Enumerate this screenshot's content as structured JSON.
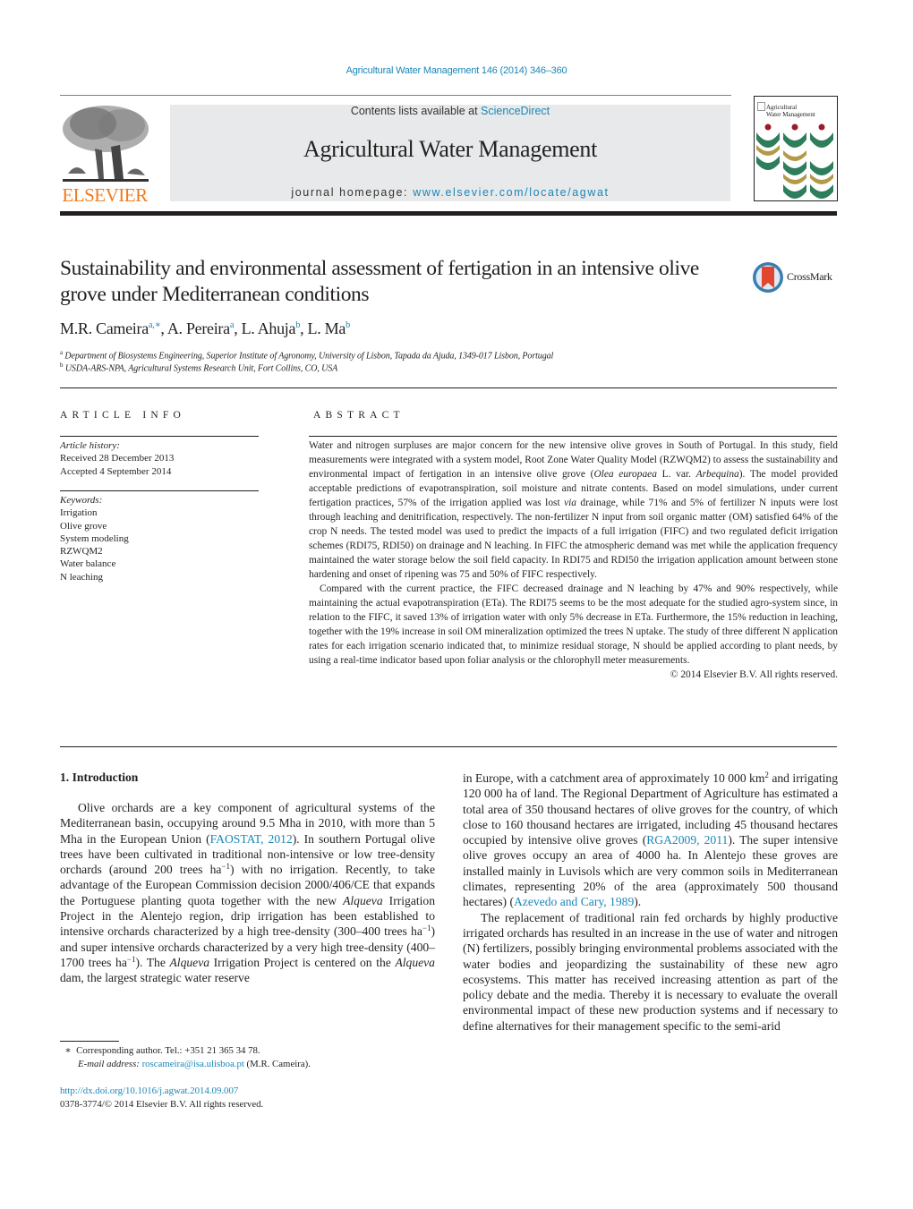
{
  "citation": "Agricultural Water Management 146 (2014) 346–360",
  "header": {
    "publisher_logo_text": "ELSEVIER",
    "contents_prefix": "Contents lists available at ",
    "contents_link": "ScienceDirect",
    "journal_title": "Agricultural Water Management",
    "homepage_prefix": "journal homepage: ",
    "homepage_link": "www.elsevier.com/locate/agwat",
    "cover_title_line1": "Agricultural",
    "cover_title_line2": "Water Management"
  },
  "article": {
    "title": "Sustainability and environmental assessment of fertigation in an intensive olive grove under Mediterranean conditions",
    "crossmark_label": "CrossMark",
    "authors": [
      {
        "name": "M.R. Cameira",
        "sup": "a,∗"
      },
      {
        "name": "A. Pereira",
        "sup": "a"
      },
      {
        "name": "L. Ahuja",
        "sup": "b"
      },
      {
        "name": "L. Ma",
        "sup": "b"
      }
    ],
    "affiliations": [
      {
        "mark": "a",
        "text": "Department of Biosystems Engineering, Superior Institute of Agronomy, University of Lisbon, Tapada da Ajuda, 1349-017 Lisbon, Portugal"
      },
      {
        "mark": "b",
        "text": "USDA-ARS-NPA, Agricultural Systems Research Unit, Fort Collins, CO, USA"
      }
    ]
  },
  "article_info": {
    "heading": "ARTICLE INFO",
    "history_label": "Article history:",
    "received": "Received 28 December 2013",
    "accepted": "Accepted 4 September 2014",
    "keywords_label": "Keywords:",
    "keywords": [
      "Irrigation",
      "Olive grove",
      "System modeling",
      "RZWQM2",
      "Water balance",
      "N leaching"
    ]
  },
  "abstract": {
    "heading": "ABSTRACT",
    "p1_a": "Water and nitrogen surpluses are major concern for the new intensive olive groves in South of Portugal. In this study, field measurements were integrated with a system model, Root Zone Water Quality Model (RZWQM2) to assess the sustainability and environmental impact of fertigation in an intensive olive grove (",
    "p1_species": "Olea europaea",
    "p1_b": " L. var. ",
    "p1_variety": "Arbequina",
    "p1_c": "). The model provided acceptable predictions of evapotranspiration, soil moisture and nitrate contents. Based on model simulations, under current fertigation practices, 57% of the irrigation applied was lost ",
    "p1_via": "via",
    "p1_d": " drainage, while 71% and 5% of fertilizer N inputs were lost through leaching and denitrification, respectively. The non-fertilizer N input from soil organic matter (OM) satisfied 64% of the crop N needs. The tested model was used to predict the impacts of a full irrigation (FIFC) and two regulated deficit irrigation schemes (RDI75, RDI50) on drainage and N leaching. In FIFC the atmospheric demand was met while the application frequency maintained the water storage below the soil field capacity. In RDI75 and RDI50 the irrigation application amount between stone hardening and onset of ripening was 75 and 50% of FIFC respectively.",
    "p2": "Compared with the current practice, the FIFC decreased drainage and N leaching by 47% and 90% respectively, while maintaining the actual evapotranspiration (ETa). The RDI75 seems to be the most adequate for the studied agro-system since, in relation to the FIFC, it saved 13% of irrigation water with only 5% decrease in ETa. Furthermore, the 15% reduction in leaching, together with the 19% increase in soil OM mineralization optimized the trees N uptake. The study of three different N application rates for each irrigation scenario indicated that, to minimize residual storage, N should be applied according to plant needs, by using a real-time indicator based upon foliar analysis or the chlorophyll meter measurements.",
    "copyright": "© 2014 Elsevier B.V. All rights reserved."
  },
  "body": {
    "section_heading": "1.  Introduction",
    "left_p1_a": "Olive orchards are a key component of agricultural systems of the Mediterranean basin, occupying around 9.5 Mha in 2010, with more than 5 Mha in the European Union (",
    "left_p1_ref": "FAOSTAT, 2012",
    "left_p1_b": "). In southern Portugal olive trees have been cultivated in traditional non-intensive or low tree-density orchards (around 200 trees ha",
    "sup_minus1": "−1",
    "left_p1_c": ") with no irrigation. Recently, to take advantage of the European Commission decision 2000/406/CE that expands the Portuguese planting quota together with the new ",
    "alqueva": "Alqueva",
    "left_p1_d": " Irrigation Project in the Alentejo region, drip irrigation has been established to intensive orchards characterized by a high tree-density (300–400 trees ha",
    "left_p1_e": ") and super intensive orchards characterized by a very high tree-density (400–1700 trees ha",
    "left_p1_f": "). The ",
    "left_p1_g": " Irrigation Project is centered on the ",
    "left_p1_h": " dam, the largest strategic water reserve",
    "right_p1_a": "in Europe, with a catchment area of approximately 10 000 km",
    "sup_2": "2",
    "right_p1_b": " and irrigating 120 000 ha of land. The Regional Department of Agriculture has estimated a total area of 350 thousand hectares of olive groves for the country, of which close to 160 thousand hectares are irrigated, including 45 thousand hectares occupied by intensive olive groves (",
    "right_p1_ref1": "RGA2009, 2011",
    "right_p1_c": "). The super intensive olive groves occupy an area of 4000 ha. In Alentejo these groves are installed mainly in Luvisols which are very common soils in Mediterranean climates, representing 20% of the area (approximately 500 thousand hectares) (",
    "right_p1_ref2": "Azevedo and Cary, 1989",
    "right_p1_d": ").",
    "right_p2": "The replacement of traditional rain fed orchards by highly productive irrigated orchards has resulted in an increase in the use of water and nitrogen (N) fertilizers, possibly bringing environmental problems associated with the water bodies and jeopardizing the sustainability of these new agro ecosystems. This matter has received increasing attention as part of the policy debate and the media. Thereby it is necessary to evaluate the overall environmental impact of these new production systems and if necessary to define alternatives for their management specific to the semi-arid"
  },
  "footnotes": {
    "star": "∗",
    "corresponding": "Corresponding author. Tel.: +351 21 365 34 78.",
    "email_label": "E-mail address:",
    "email": "roscameira@isa.ulisboa.pt",
    "email_suffix": " (M.R. Cameira).",
    "doi": "http://dx.doi.org/10.1016/j.agwat.2014.09.007",
    "issn_copyright": "0378-3774/© 2014 Elsevier B.V. All rights reserved."
  },
  "colors": {
    "link": "#1a87b8",
    "elsevier_orange": "#f07a1b",
    "header_box": "#e8e9ea"
  }
}
